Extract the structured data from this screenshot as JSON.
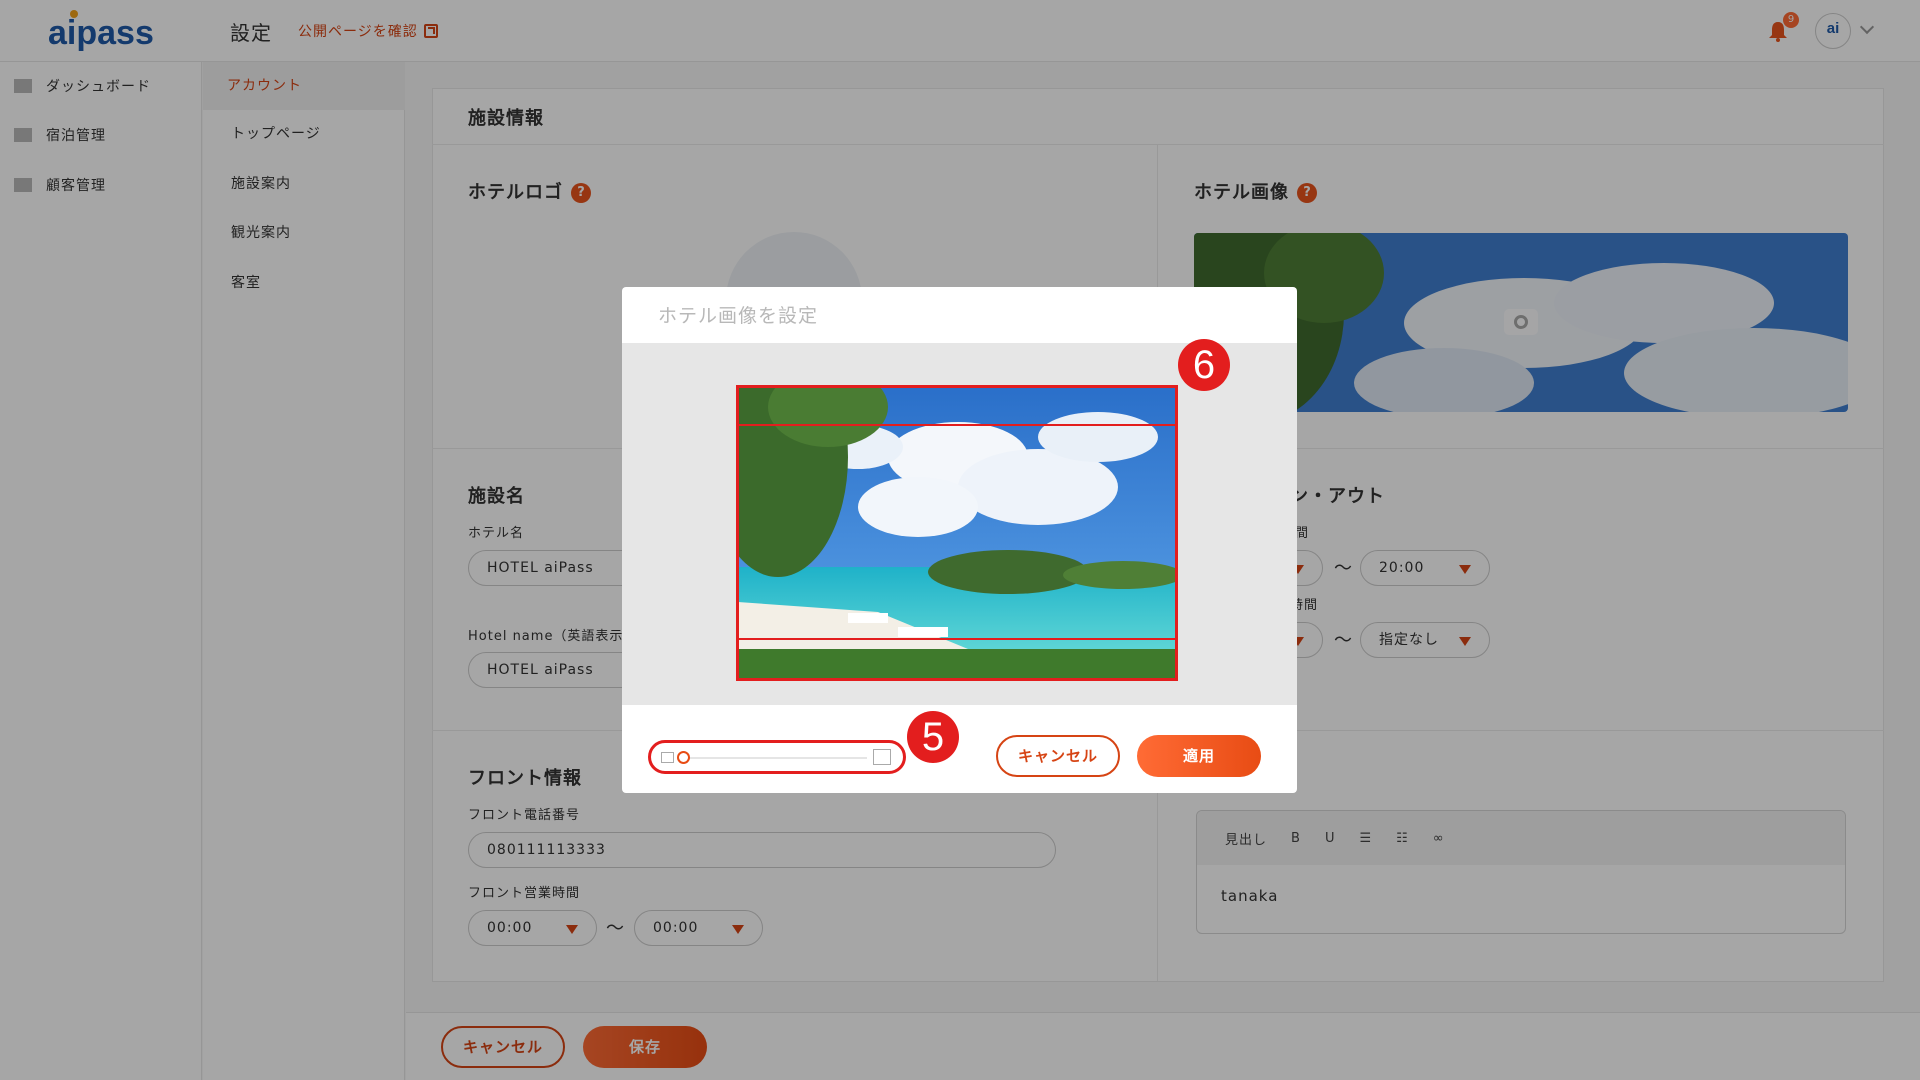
{
  "header": {
    "logo": "aipass",
    "title": "設定",
    "public_link": "公開ページを確認",
    "notification_count": "9",
    "avatar_text": "ai"
  },
  "nav": {
    "items": [
      {
        "label": "ダッシュボード",
        "icon": "dashboard-icon"
      },
      {
        "label": "宿泊管理",
        "icon": "bed-icon"
      },
      {
        "label": "顧客管理",
        "icon": "customer-icon"
      }
    ]
  },
  "subnav": {
    "items": [
      {
        "label": "アカウント",
        "active": true
      },
      {
        "label": "トップページ"
      },
      {
        "label": "施設案内"
      },
      {
        "label": "観光案内"
      },
      {
        "label": "客室"
      }
    ]
  },
  "main": {
    "card_title": "施設情報",
    "logo_title": "ホテルロゴ",
    "image_title": "ホテル画像",
    "help_mark": "?",
    "facility_section": "施設名",
    "hotel_name_label": "ホテル名",
    "hotel_name_value": "HOTEL aiPass",
    "hotel_name_en_label": "Hotel name（英語表示",
    "hotel_name_en_value": "HOTEL aiPass",
    "checkin_section": "ン・アウト",
    "checkin_time_label": "間",
    "checkout_time_label": "時間",
    "checkin_to": "20:00",
    "checkout_to": "指定なし",
    "front_section": "フロント情報",
    "front_phone_label": "フロント電話番号",
    "front_phone_value": "080111113333",
    "front_hours_label": "フロント営業時間",
    "front_hours_from": "00:00",
    "front_hours_to": "00:00",
    "tilde": "〜",
    "editor_toolbar": [
      "見出し",
      "B",
      "U",
      "☰",
      "☷",
      "∞"
    ],
    "editor_text": "tanaka"
  },
  "footer": {
    "cancel": "キャンセル",
    "save": "保存"
  },
  "modal": {
    "title": "ホテル画像を設定",
    "cancel": "キャンセル",
    "apply": "適用",
    "zoom_level": 0.0
  },
  "markers": {
    "crop": "6",
    "zoom": "5"
  },
  "colors": {
    "accent": "#e84c14",
    "brand": "#1f5aa8",
    "annotation": "#e31e1e"
  }
}
